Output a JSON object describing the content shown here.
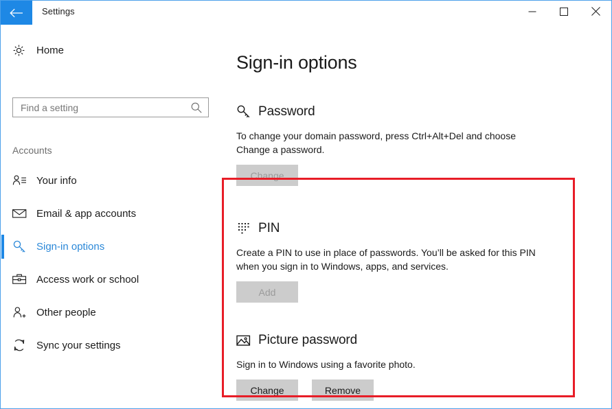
{
  "window": {
    "title": "Settings",
    "back_icon": "back-arrow-icon",
    "controls": {
      "minimize": "minimize-icon",
      "maximize": "maximize-icon",
      "close": "close-icon"
    },
    "accent_color": "#1e88e5",
    "border_color": "#4ca0ea",
    "highlight_color": "#e81d27"
  },
  "sidebar": {
    "home": {
      "label": "Home",
      "icon": "gear-icon"
    },
    "search": {
      "placeholder": "Find a setting",
      "value": "",
      "icon": "search-icon"
    },
    "group_title": "Accounts",
    "items": [
      {
        "label": "Your info",
        "icon": "user-info-icon",
        "selected": false
      },
      {
        "label": "Email & app accounts",
        "icon": "envelope-icon",
        "selected": false
      },
      {
        "label": "Sign-in options",
        "icon": "key-icon",
        "selected": true
      },
      {
        "label": "Access work or school",
        "icon": "briefcase-icon",
        "selected": false
      },
      {
        "label": "Other people",
        "icon": "user-add-icon",
        "selected": false
      },
      {
        "label": "Sync your settings",
        "icon": "sync-icon",
        "selected": false
      }
    ]
  },
  "main": {
    "title": "Sign-in options",
    "sections": [
      {
        "heading": "Password",
        "icon": "key-icon",
        "description": "To change your domain password, press Ctrl+Alt+Del and choose Change a password.",
        "buttons": [
          {
            "label": "Change",
            "disabled": true
          }
        ]
      },
      {
        "heading": "PIN",
        "icon": "keypad-dots-icon",
        "description": "Create a PIN to use in place of passwords. You’ll be asked for this PIN when you sign in to Windows, apps, and services.",
        "buttons": [
          {
            "label": "Add",
            "disabled": true
          }
        ]
      },
      {
        "heading": "Picture password",
        "icon": "picture-icon",
        "description": "Sign in to Windows using a favorite photo.",
        "buttons": [
          {
            "label": "Change",
            "disabled": false
          },
          {
            "label": "Remove",
            "disabled": false
          }
        ]
      }
    ]
  }
}
